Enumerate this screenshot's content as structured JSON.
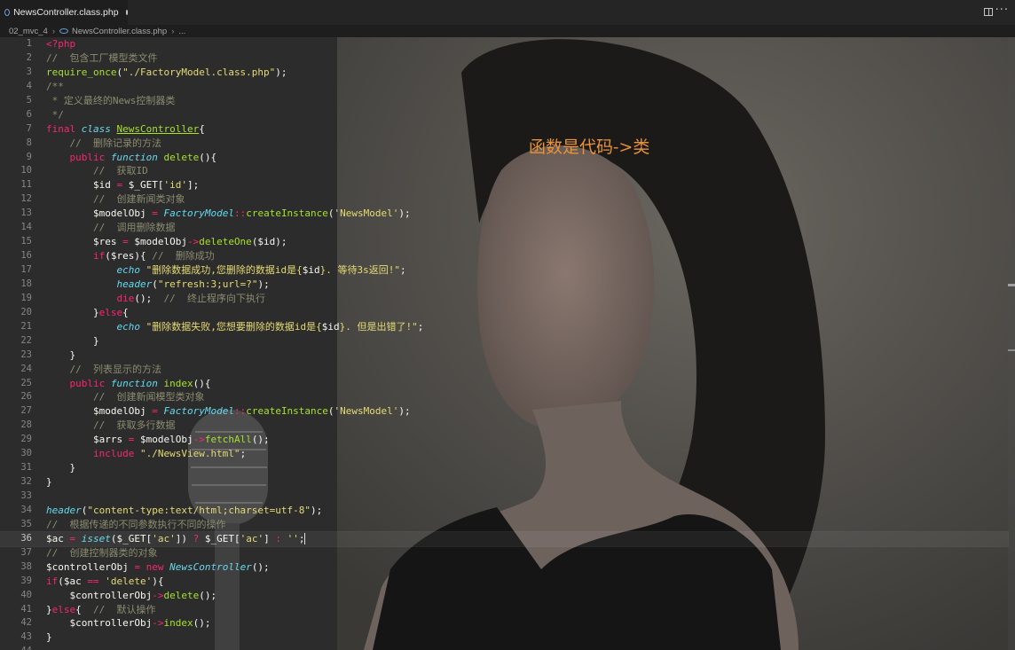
{
  "tab": {
    "filename": "NewsController.class.php"
  },
  "breadcrumb": {
    "folder": "02_mvc_4",
    "file": "NewsController.class.php",
    "tail": "..."
  },
  "annotation": "函数是代码->类",
  "code_lines": [
    {
      "n": "1",
      "toks": [
        [
          "kw",
          "<?php"
        ]
      ]
    },
    {
      "n": "2",
      "toks": [
        [
          "cmt",
          "//  包含工厂模型类文件"
        ]
      ]
    },
    {
      "n": "3",
      "toks": [
        [
          "fn",
          "require_once"
        ],
        [
          "pun",
          "("
        ],
        [
          "str",
          "\"./FactoryModel.class.php\""
        ],
        [
          "pun",
          ");"
        ]
      ]
    },
    {
      "n": "4",
      "toks": [
        [
          "cmt",
          "/**"
        ]
      ]
    },
    {
      "n": "5",
      "toks": [
        [
          "cmt",
          " * 定义最终的News控制器类"
        ]
      ]
    },
    {
      "n": "6",
      "toks": [
        [
          "cmt",
          " */"
        ]
      ]
    },
    {
      "n": "7",
      "toks": [
        [
          "kw",
          "final "
        ],
        [
          "cls",
          "class "
        ],
        [
          "fn ul",
          "NewsController"
        ],
        [
          "pun",
          "{"
        ]
      ]
    },
    {
      "n": "8",
      "toks": [
        [
          "pun",
          "    "
        ],
        [
          "cmt",
          "//  删除记录的方法"
        ]
      ]
    },
    {
      "n": "9",
      "toks": [
        [
          "pun",
          "    "
        ],
        [
          "kw",
          "public "
        ],
        [
          "cls",
          "function "
        ],
        [
          "fn",
          "delete"
        ],
        [
          "pun",
          "(){"
        ]
      ]
    },
    {
      "n": "10",
      "toks": [
        [
          "pun",
          "        "
        ],
        [
          "cmt",
          "//  获取ID"
        ]
      ]
    },
    {
      "n": "11",
      "toks": [
        [
          "var",
          "        $id "
        ],
        [
          "op",
          "= "
        ],
        [
          "var",
          "$_GET["
        ],
        [
          "str",
          "'id'"
        ],
        [
          "pun",
          "];"
        ]
      ]
    },
    {
      "n": "12",
      "toks": [
        [
          "pun",
          "        "
        ],
        [
          "cmt",
          "//  创建新闻类对象"
        ]
      ]
    },
    {
      "n": "13",
      "toks": [
        [
          "var",
          "        $modelObj "
        ],
        [
          "op",
          "= "
        ],
        [
          "cls",
          "FactoryModel"
        ],
        [
          "op",
          "::"
        ],
        [
          "fn",
          "createInstance"
        ],
        [
          "pun",
          "("
        ],
        [
          "str",
          "'NewsModel'"
        ],
        [
          "pun",
          ");"
        ]
      ]
    },
    {
      "n": "14",
      "toks": [
        [
          "pun",
          "        "
        ],
        [
          "cmt",
          "//  调用删除数据"
        ]
      ]
    },
    {
      "n": "15",
      "toks": [
        [
          "var",
          "        $res "
        ],
        [
          "op",
          "= "
        ],
        [
          "var",
          "$modelObj"
        ],
        [
          "op",
          "->"
        ],
        [
          "fn",
          "deleteOne"
        ],
        [
          "pun",
          "($id);"
        ]
      ]
    },
    {
      "n": "16",
      "toks": [
        [
          "pun",
          "        "
        ],
        [
          "kw",
          "if"
        ],
        [
          "pun",
          "($res){ "
        ],
        [
          "cmt",
          "//  删除成功"
        ]
      ]
    },
    {
      "n": "17",
      "toks": [
        [
          "pun",
          "            "
        ],
        [
          "cls",
          "echo "
        ],
        [
          "str",
          "\"删除数据成功,您删除的数据id是{"
        ],
        [
          "var",
          "$id"
        ],
        [
          "str",
          "}. 等待3s返回!\""
        ],
        [
          "pun",
          ";"
        ]
      ]
    },
    {
      "n": "18",
      "toks": [
        [
          "pun",
          "            "
        ],
        [
          "cls",
          "header"
        ],
        [
          "pun",
          "("
        ],
        [
          "str",
          "\"refresh:3;url=?\""
        ],
        [
          "pun",
          ");"
        ]
      ]
    },
    {
      "n": "19",
      "toks": [
        [
          "pun",
          "            "
        ],
        [
          "kw",
          "die"
        ],
        [
          "pun",
          "();  "
        ],
        [
          "cmt",
          "//  终止程序向下执行"
        ]
      ]
    },
    {
      "n": "20",
      "toks": [
        [
          "pun",
          "        }"
        ],
        [
          "kw",
          "else"
        ],
        [
          "pun",
          "{"
        ]
      ]
    },
    {
      "n": "21",
      "toks": [
        [
          "pun",
          "            "
        ],
        [
          "cls",
          "echo "
        ],
        [
          "str",
          "\"删除数据失败,您想要删除的数据id是{"
        ],
        [
          "var",
          "$id"
        ],
        [
          "str",
          "}. 但是出错了!\""
        ],
        [
          "pun",
          ";"
        ]
      ]
    },
    {
      "n": "22",
      "toks": [
        [
          "pun",
          "        }"
        ]
      ]
    },
    {
      "n": "23",
      "toks": [
        [
          "pun",
          "    }"
        ]
      ]
    },
    {
      "n": "24",
      "toks": [
        [
          "pun",
          "    "
        ],
        [
          "cmt",
          "//  列表显示的方法"
        ]
      ]
    },
    {
      "n": "25",
      "toks": [
        [
          "pun",
          "    "
        ],
        [
          "kw",
          "public "
        ],
        [
          "cls",
          "function "
        ],
        [
          "fn",
          "index"
        ],
        [
          "pun",
          "(){"
        ]
      ]
    },
    {
      "n": "26",
      "toks": [
        [
          "pun",
          "        "
        ],
        [
          "cmt",
          "//  创建新闻模型类对象"
        ]
      ]
    },
    {
      "n": "27",
      "toks": [
        [
          "var",
          "        $modelObj "
        ],
        [
          "op",
          "= "
        ],
        [
          "cls",
          "FactoryModel"
        ],
        [
          "op",
          "::"
        ],
        [
          "fn",
          "createInstance"
        ],
        [
          "pun",
          "("
        ],
        [
          "str",
          "'NewsModel'"
        ],
        [
          "pun",
          ");"
        ]
      ]
    },
    {
      "n": "28",
      "toks": [
        [
          "pun",
          "        "
        ],
        [
          "cmt",
          "//  获取多行数据"
        ]
      ]
    },
    {
      "n": "29",
      "toks": [
        [
          "var",
          "        $arrs "
        ],
        [
          "op",
          "= "
        ],
        [
          "var",
          "$modelObj"
        ],
        [
          "op",
          "->"
        ],
        [
          "fn",
          "fetchAll"
        ],
        [
          "pun",
          "();"
        ]
      ]
    },
    {
      "n": "30",
      "toks": [
        [
          "pun",
          "        "
        ],
        [
          "kw",
          "include "
        ],
        [
          "str",
          "\"./NewsView.html\""
        ],
        [
          "pun",
          ";"
        ]
      ]
    },
    {
      "n": "31",
      "toks": [
        [
          "pun",
          "    }"
        ]
      ]
    },
    {
      "n": "32",
      "toks": [
        [
          "pun",
          "}"
        ]
      ]
    },
    {
      "n": "33",
      "toks": [
        [
          "pun",
          ""
        ]
      ]
    },
    {
      "n": "34",
      "toks": [
        [
          "cls",
          "header"
        ],
        [
          "pun",
          "("
        ],
        [
          "str",
          "\"content-type:text/html;charset=utf-8\""
        ],
        [
          "pun",
          ");"
        ]
      ]
    },
    {
      "n": "35",
      "toks": [
        [
          "cmt",
          "//  根据传递的不同参数执行不同的操作"
        ]
      ]
    },
    {
      "n": "36",
      "toks": [
        [
          "var",
          "$ac "
        ],
        [
          "op",
          "= "
        ],
        [
          "cls",
          "isset"
        ],
        [
          "pun",
          "($_GET["
        ],
        [
          "str",
          "'ac'"
        ],
        [
          "pun",
          "]) "
        ],
        [
          "op",
          "? "
        ],
        [
          "var",
          "$_GET["
        ],
        [
          "str",
          "'ac'"
        ],
        [
          "pun",
          "] "
        ],
        [
          "op",
          ": "
        ],
        [
          "str",
          "''"
        ],
        [
          "pun",
          ";"
        ]
      ]
    },
    {
      "n": "37",
      "toks": [
        [
          "cmt",
          "//  创建控制器类的对象"
        ]
      ]
    },
    {
      "n": "38",
      "toks": [
        [
          "var",
          "$controllerObj "
        ],
        [
          "op",
          "= "
        ],
        [
          "kw",
          "new "
        ],
        [
          "cls",
          "NewsController"
        ],
        [
          "pun",
          "();"
        ]
      ]
    },
    {
      "n": "39",
      "toks": [
        [
          "kw",
          "if"
        ],
        [
          "pun",
          "($ac "
        ],
        [
          "op",
          "== "
        ],
        [
          "str",
          "'delete'"
        ],
        [
          "pun",
          "){"
        ]
      ]
    },
    {
      "n": "40",
      "toks": [
        [
          "var",
          "    $controllerObj"
        ],
        [
          "op",
          "->"
        ],
        [
          "fn",
          "delete"
        ],
        [
          "pun",
          "();"
        ]
      ]
    },
    {
      "n": "41",
      "toks": [
        [
          "pun",
          "}"
        ],
        [
          "kw",
          "else"
        ],
        [
          "pun",
          "{  "
        ],
        [
          "cmt",
          "//  默认操作"
        ]
      ]
    },
    {
      "n": "42",
      "toks": [
        [
          "var",
          "    $controllerObj"
        ],
        [
          "op",
          "->"
        ],
        [
          "fn",
          "index"
        ],
        [
          "pun",
          "();"
        ]
      ]
    },
    {
      "n": "43",
      "toks": [
        [
          "pun",
          "}"
        ]
      ]
    },
    {
      "n": "44",
      "toks": [
        [
          "pun",
          ""
        ]
      ]
    }
  ],
  "current_line": "36"
}
